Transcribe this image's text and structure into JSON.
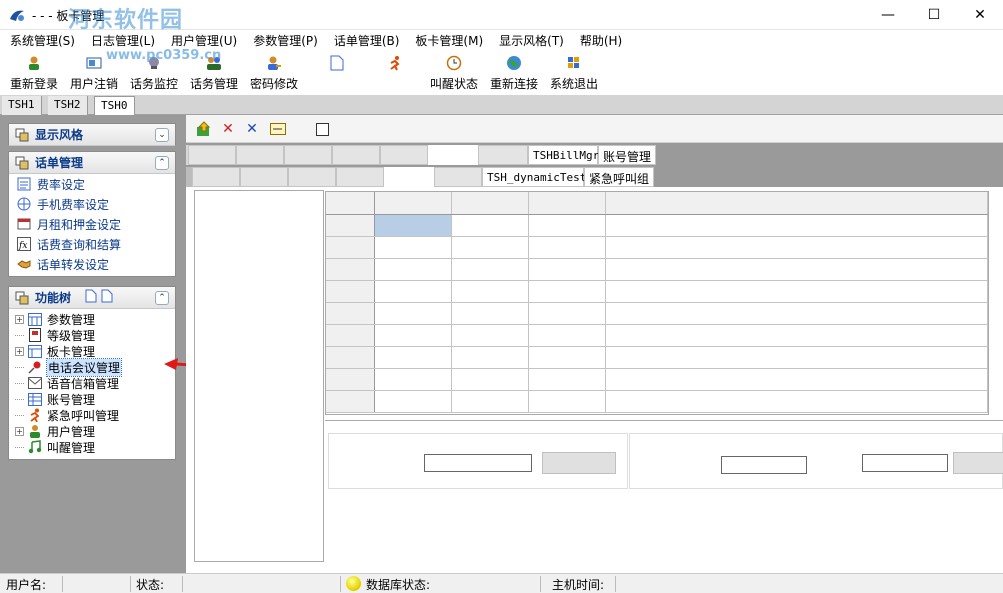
{
  "window": {
    "title": "- - - 板卡管理",
    "watermark": "河东软件园",
    "watermark_url": "www.pc0359.cn",
    "controls": {
      "minimize": "—",
      "maximize": "☐",
      "close": "✕"
    }
  },
  "menu": [
    "系统管理(S)",
    "日志管理(L)",
    "用户管理(U)",
    "参数管理(P)",
    "话单管理(B)",
    "板卡管理(M)",
    "显示风格(T)",
    "帮助(H)"
  ],
  "toolbar": {
    "relogin": "重新登录",
    "logout": "用户注销",
    "monitor": "话务监控",
    "traffic": "话务管理",
    "password": "密码修改",
    "wake_status": "叫醒状态",
    "reconnect": "重新连接",
    "exit": "系统退出"
  },
  "session_tabs": [
    "TSH1",
    "TSH2",
    "TSH0"
  ],
  "left": {
    "style_panel": {
      "title": "显示风格"
    },
    "bill_panel": {
      "title": "话单管理",
      "items": [
        "费率设定",
        "手机费率设定",
        "月租和押金设定",
        "话费查询和结算",
        "话单转发设定"
      ]
    },
    "tree_panel": {
      "title": "功能树",
      "items": [
        "参数管理",
        "等级管理",
        "板卡管理",
        "电话会议管理",
        "语音信箱管理",
        "账号管理",
        "紧急呼叫管理",
        "用户管理",
        "叫醒管理"
      ]
    }
  },
  "right": {
    "tabrow1": {
      "mono": "TSHBillMgr",
      "label": "账号管理"
    },
    "tabrow2": {
      "mono": "TSH_dynamicTest",
      "label": "紧急呼叫组"
    }
  },
  "status": {
    "user": "用户名:",
    "state": "状态:",
    "db_state": "数据库状态:",
    "host_time": "主机时间:"
  }
}
